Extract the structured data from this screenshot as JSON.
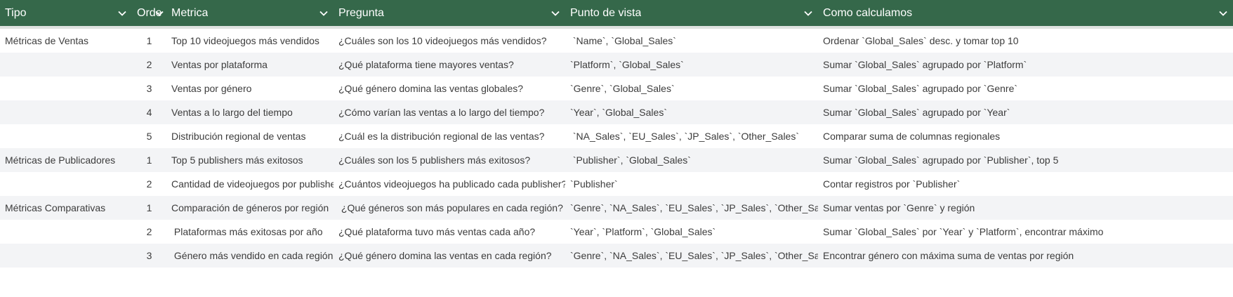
{
  "colors": {
    "header_bg": "#35684a",
    "header_text": "#ffffff",
    "row_alt_bg": "#f3f4f6",
    "body_text": "#3c3c3c"
  },
  "header": {
    "columns": [
      {
        "label": "Tipo",
        "icon": "chevron-down-icon"
      },
      {
        "label": "Orde",
        "icon": "chevron-down-icon"
      },
      {
        "label": "Metrica",
        "icon": "chevron-down-icon"
      },
      {
        "label": "Pregunta",
        "icon": "chevron-down-icon"
      },
      {
        "label": "Punto de vista",
        "icon": "chevron-down-icon"
      },
      {
        "label": "Como calculamos",
        "icon": "chevron-down-icon"
      }
    ]
  },
  "rows": [
    {
      "tipo": "Métricas de Ventas",
      "orden": "1",
      "metrica": "Top 10 videojuegos más vendidos",
      "pregunta": "¿Cuáles son los 10 videojuegos más vendidos?",
      "punto": " `Name`, `Global_Sales`",
      "como": "Ordenar `Global_Sales` desc. y tomar top 10"
    },
    {
      "tipo": "",
      "orden": "2",
      "metrica": "Ventas por plataforma",
      "pregunta": "¿Qué plataforma tiene mayores ventas?",
      "punto": "`Platform`, `Global_Sales`",
      "como": "Sumar `Global_Sales` agrupado por `Platform`"
    },
    {
      "tipo": "",
      "orden": "3",
      "metrica": "Ventas por género",
      "pregunta": "¿Qué género domina las ventas globales?",
      "punto": "`Genre`, `Global_Sales`",
      "como": "Sumar `Global_Sales` agrupado por `Genre`"
    },
    {
      "tipo": "",
      "orden": "4",
      "metrica": "Ventas a lo largo del tiempo",
      "pregunta": "¿Cómo varían las ventas a lo largo del tiempo?",
      "punto": "`Year`, `Global_Sales`",
      "como": "Sumar `Global_Sales` agrupado por `Year`"
    },
    {
      "tipo": "",
      "orden": "5",
      "metrica": "Distribución regional de ventas",
      "pregunta": "¿Cuál es la distribución regional de las ventas?",
      "punto": " `NA_Sales`, `EU_Sales`, `JP_Sales`, `Other_Sales`",
      "como": "Comparar suma de columnas regionales"
    },
    {
      "tipo": "Métricas de Publicadores",
      "orden": "1",
      "metrica": "Top 5 publishers más exitosos",
      "pregunta": "¿Cuáles son los 5 publishers más exitosos?",
      "punto": " `Publisher`, `Global_Sales`",
      "como": "Sumar `Global_Sales` agrupado por `Publisher`, top 5"
    },
    {
      "tipo": "",
      "orden": "2",
      "metrica": "Cantidad de videojuegos por publisher",
      "pregunta": "¿Cuántos videojuegos ha publicado cada publisher?",
      "punto": "`Publisher`",
      "como": "Contar registros por `Publisher`"
    },
    {
      "tipo": "Métricas Comparativas",
      "orden": "1",
      "metrica": "Comparación de géneros por región",
      "pregunta": " ¿Qué géneros son más populares en cada región?",
      "punto": "`Genre`, `NA_Sales`, `EU_Sales`, `JP_Sales`, `Other_Sales`",
      "como": "Sumar ventas por `Genre` y región"
    },
    {
      "tipo": "",
      "orden": "2",
      "metrica": " Plataformas más exitosas por año",
      "pregunta": "¿Qué plataforma tuvo más ventas cada año?",
      "punto": "`Year`, `Platform`, `Global_Sales`",
      "como": "Sumar `Global_Sales` por `Year` y `Platform`, encontrar máximo"
    },
    {
      "tipo": "",
      "orden": "3",
      "metrica": " Género más vendido en cada región",
      "pregunta": "¿Qué género domina las ventas en cada región?",
      "punto": "`Genre`, `NA_Sales`, `EU_Sales`, `JP_Sales`, `Other_Sales`",
      "como": "Encontrar género con máxima suma de ventas por región"
    }
  ]
}
